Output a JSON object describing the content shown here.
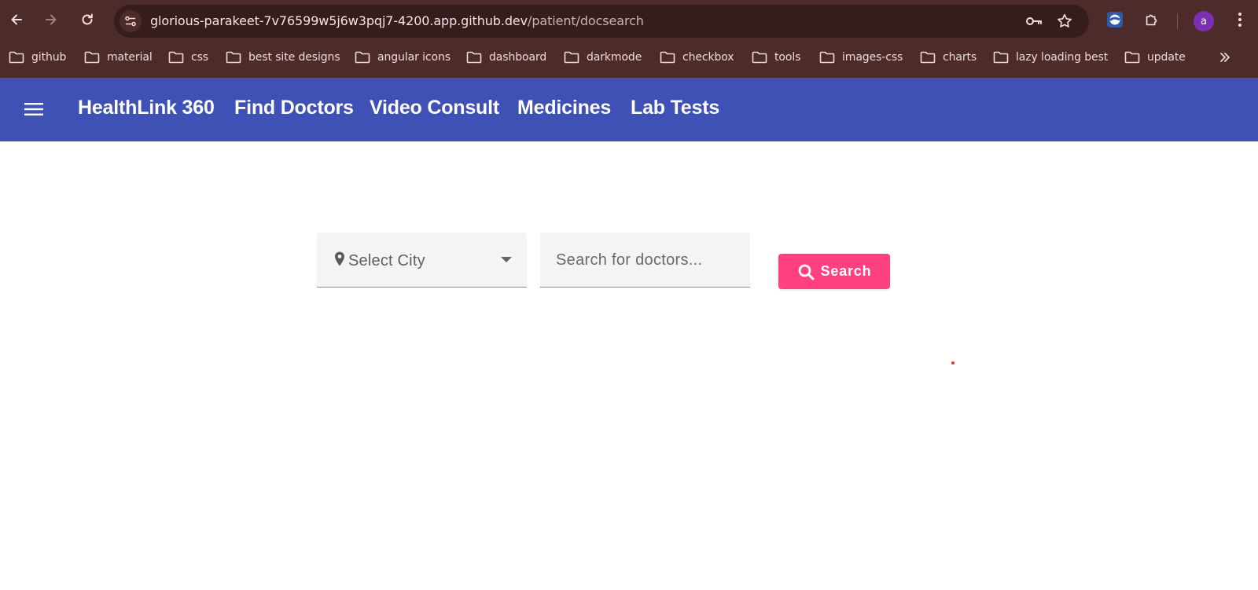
{
  "browser": {
    "url_host": "glorious-parakeet-7v76599w5j6w3pqj7-4200.app.github.dev",
    "url_path": "/patient/docsearch",
    "profile_initial": "a",
    "icons": [
      "back-arrow-icon",
      "forward-arrow-icon",
      "reload-icon",
      "site-info-icon",
      "password-key-icon",
      "bookmark-star-icon",
      "extension-app-icon",
      "extensions-puzzle-icon",
      "more-menu-icon",
      "bookmarks-overflow-icon"
    ],
    "bookmarks": [
      "github",
      "material",
      "css",
      "best site designs",
      "angular icons",
      "dashboard",
      "darkmode",
      "checkbox",
      "tools",
      "images-css",
      "charts",
      "lazy loading best",
      "update"
    ]
  },
  "app": {
    "brand": "HealthLink 360",
    "nav": [
      "Find Doctors",
      "Video Consult",
      "Medicines",
      "Lab Tests"
    ],
    "header_color": "#3f51b5"
  },
  "search": {
    "city_placeholder": "Select City",
    "doctor_placeholder": "Search for doctors...",
    "button_label": "Search",
    "button_color": "#ff4081"
  }
}
